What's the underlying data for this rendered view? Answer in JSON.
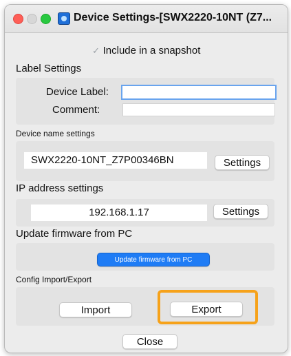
{
  "window": {
    "title": "Device Settings-[SWX2220-10NT (Z7..."
  },
  "snapshot": {
    "label": "Include in a snapshot",
    "checked": true
  },
  "label_settings": {
    "heading": "Label Settings",
    "device_label": "Device Label:",
    "device_label_value": "",
    "comment": "Comment:",
    "comment_value": ""
  },
  "device_name": {
    "heading": "Device name settings",
    "value": "SWX2220-10NT_Z7P00346BN",
    "button": "Settings"
  },
  "ip_address": {
    "heading": "IP address settings",
    "value": "192.168.1.17",
    "button": "Settings"
  },
  "firmware": {
    "heading": "Update firmware from PC",
    "button": "Update firmware from PC"
  },
  "config": {
    "heading": "Config Import/Export",
    "import_button": "Import",
    "export_button": "Export"
  },
  "footer": {
    "close_button": "Close"
  },
  "colors": {
    "highlight": "#f6a21a",
    "accent_button": "#1f7cf5",
    "focus_ring": "#69a4ee"
  }
}
